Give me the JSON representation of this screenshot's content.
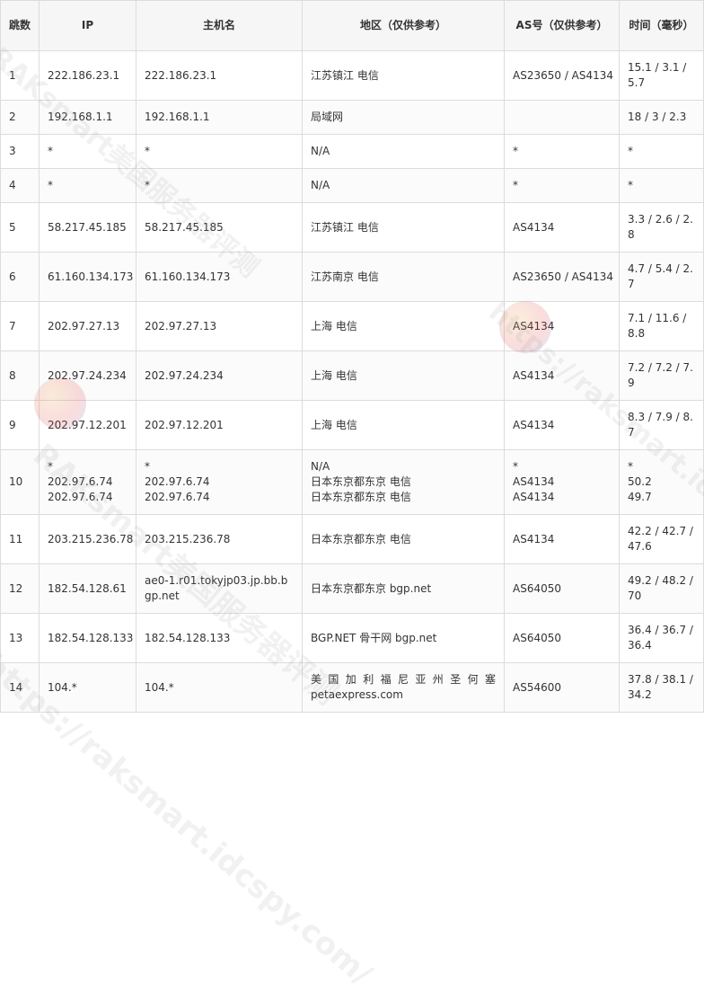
{
  "columns": [
    "跳数",
    "IP",
    "主机名",
    "地区（仅供参考）",
    "AS号（仅供参考）",
    "时间（毫秒）"
  ],
  "rows": [
    {
      "hop": "1",
      "ip": [
        "222.186.23.1"
      ],
      "host": [
        "222.186.23.1"
      ],
      "region": [
        "江苏镇江 电信"
      ],
      "asn": [
        "AS23650 / AS4134"
      ],
      "time": [
        "15.1 / 3.1 / 5.7"
      ]
    },
    {
      "hop": "2",
      "ip": [
        "192.168.1.1"
      ],
      "host": [
        "192.168.1.1"
      ],
      "region": [
        "局域网"
      ],
      "asn": [
        ""
      ],
      "time": [
        "18 / 3 / 2.3"
      ]
    },
    {
      "hop": "3",
      "ip": [
        "*"
      ],
      "host": [
        "*"
      ],
      "region": [
        "N/A"
      ],
      "asn": [
        "*"
      ],
      "time": [
        "*"
      ]
    },
    {
      "hop": "4",
      "ip": [
        "*"
      ],
      "host": [
        "*"
      ],
      "region": [
        "N/A"
      ],
      "asn": [
        "*"
      ],
      "time": [
        "*"
      ]
    },
    {
      "hop": "5",
      "ip": [
        "58.217.45.185"
      ],
      "host": [
        "58.217.45.185"
      ],
      "region": [
        "江苏镇江 电信"
      ],
      "asn": [
        "AS4134"
      ],
      "time": [
        "3.3 / 2.6 / 2.8"
      ]
    },
    {
      "hop": "6",
      "ip": [
        "61.160.134.173"
      ],
      "host": [
        "61.160.134.173"
      ],
      "region": [
        "江苏南京 电信"
      ],
      "asn": [
        "AS23650 / AS4134"
      ],
      "time": [
        "4.7 / 5.4 / 2.7"
      ]
    },
    {
      "hop": "7",
      "ip": [
        "202.97.27.13"
      ],
      "host": [
        "202.97.27.13"
      ],
      "region": [
        "上海 电信"
      ],
      "asn": [
        "AS4134"
      ],
      "time": [
        "7.1 / 11.6 / 8.8"
      ]
    },
    {
      "hop": "8",
      "ip": [
        "202.97.24.234"
      ],
      "host": [
        "202.97.24.234"
      ],
      "region": [
        "上海 电信"
      ],
      "asn": [
        "AS4134"
      ],
      "time": [
        "7.2 / 7.2 / 7.9"
      ]
    },
    {
      "hop": "9",
      "ip": [
        "202.97.12.201"
      ],
      "host": [
        "202.97.12.201"
      ],
      "region": [
        "上海 电信"
      ],
      "asn": [
        "AS4134"
      ],
      "time": [
        "8.3 / 7.9 / 8.7"
      ]
    },
    {
      "hop": "10",
      "ip": [
        "*",
        "202.97.6.74",
        "202.97.6.74"
      ],
      "host": [
        "*",
        "202.97.6.74",
        "202.97.6.74"
      ],
      "region": [
        "N/A",
        "日本东京都东京 电信",
        "日本东京都东京 电信"
      ],
      "asn": [
        "*",
        "AS4134",
        "AS4134"
      ],
      "time": [
        "*",
        "50.2",
        "49.7"
      ]
    },
    {
      "hop": "11",
      "ip": [
        "203.215.236.78"
      ],
      "host": [
        "203.215.236.78"
      ],
      "region": [
        "日本东京都东京 电信"
      ],
      "asn": [
        "AS4134"
      ],
      "time": [
        "42.2 / 42.7 / 47.6"
      ]
    },
    {
      "hop": "12",
      "ip": [
        "182.54.128.61"
      ],
      "host": [
        "ae0-1.r01.tokyjp03.jp.bb.bgp.net"
      ],
      "region": [
        "日本东京都东京 bgp.net"
      ],
      "asn": [
        "AS64050"
      ],
      "time": [
        "49.2 / 48.2 / 70"
      ]
    },
    {
      "hop": "13",
      "ip": [
        "182.54.128.133"
      ],
      "host": [
        "182.54.128.133"
      ],
      "region": [
        "BGP.NET 骨干网 bgp.net"
      ],
      "asn": [
        "AS64050"
      ],
      "time": [
        "36.4 / 36.7 / 36.4"
      ]
    },
    {
      "hop": "14",
      "ip": [
        "104.*"
      ],
      "host": [
        "104.*"
      ],
      "region": [
        "美 国 加 利 福 尼 亚 州 圣 何 塞",
        "petaexpress.com"
      ],
      "asn": [
        "AS54600"
      ],
      "time": [
        "37.8 / 38.1 / 34.2"
      ]
    }
  ],
  "watermark": {
    "line1": "RAKsmart美国服务器评测",
    "line2": "https://raksmart.idcspy.com/"
  }
}
